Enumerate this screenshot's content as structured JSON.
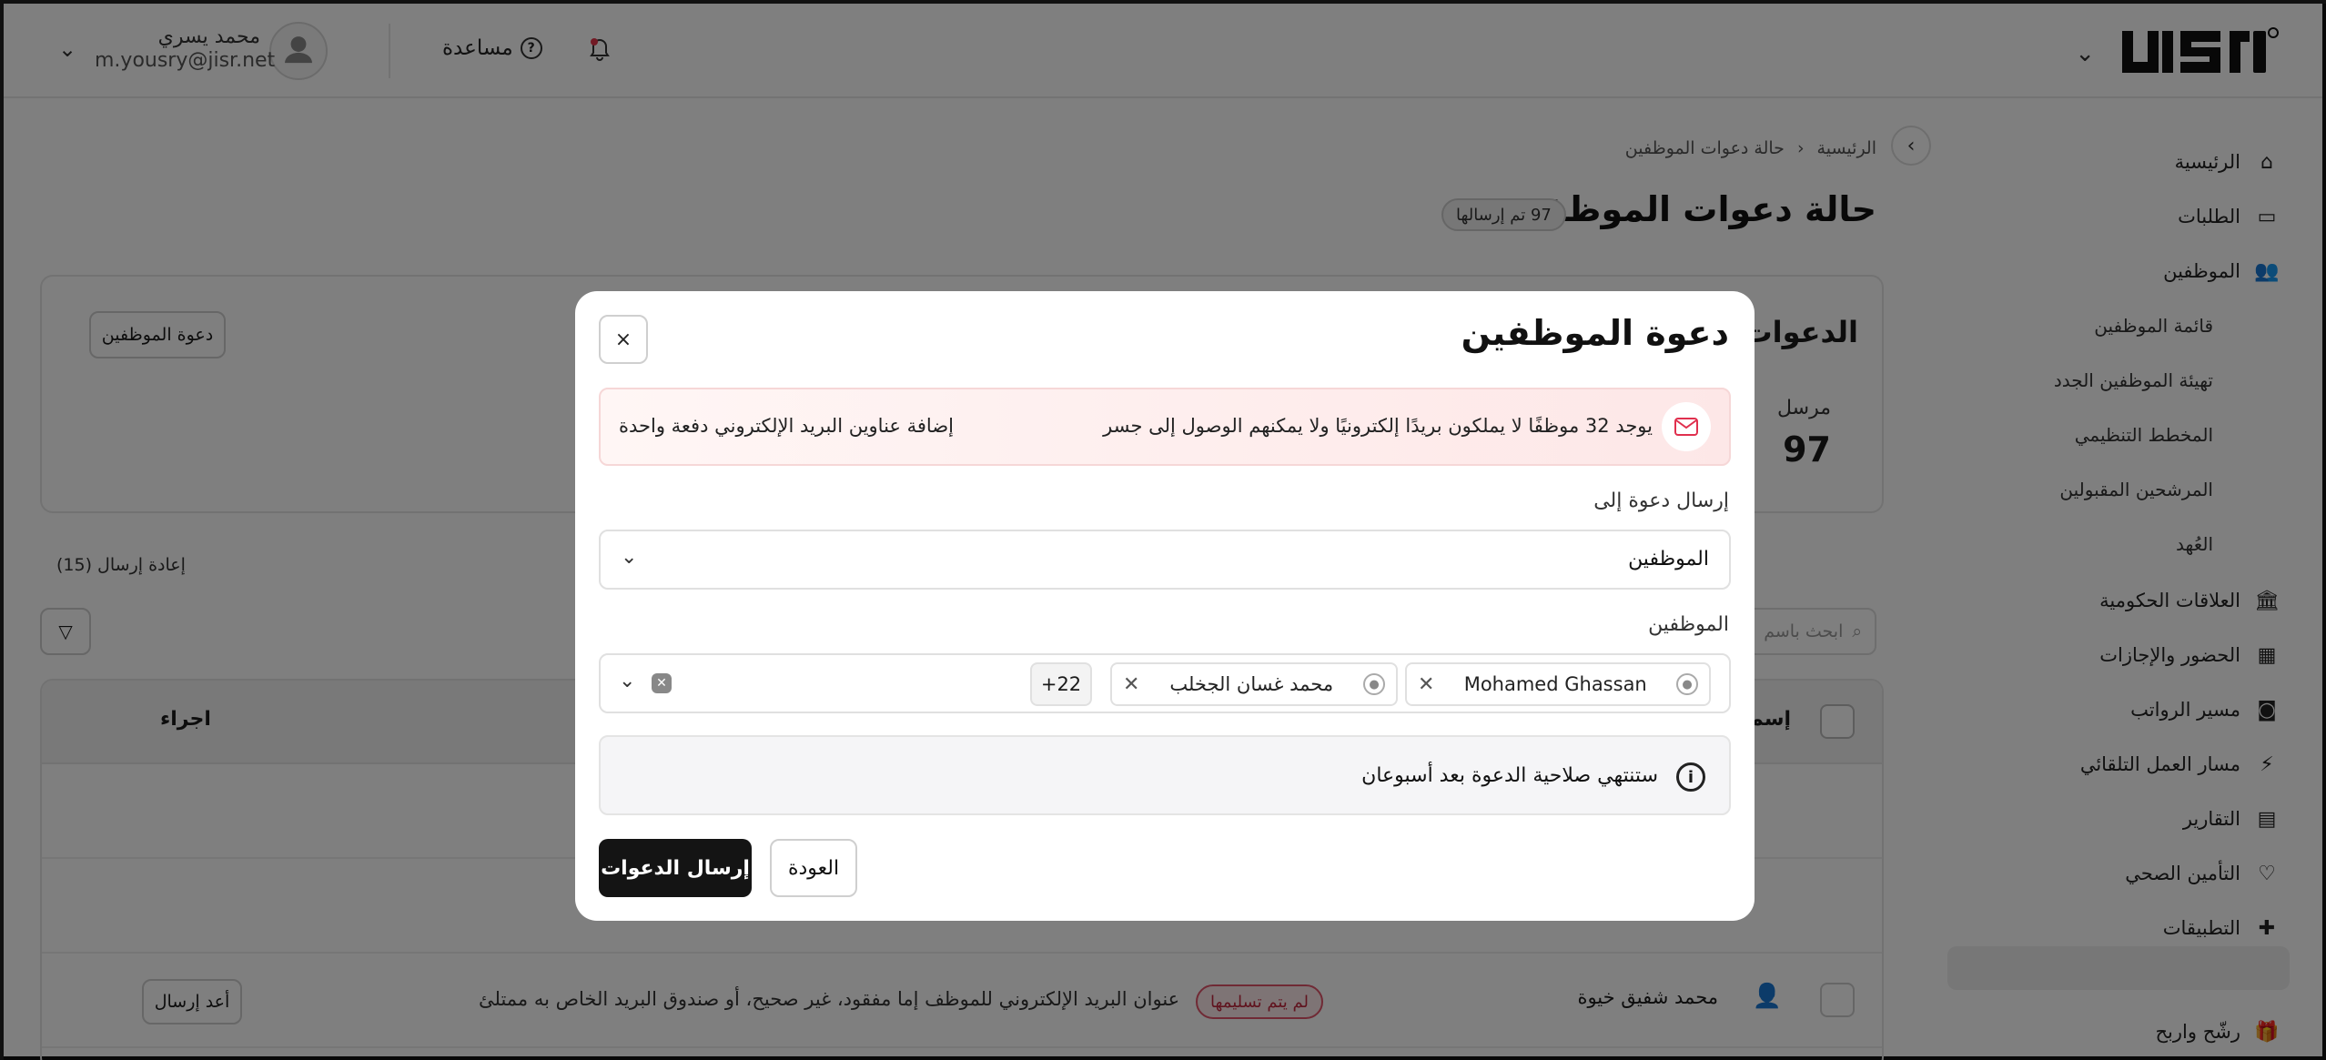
{
  "topbar": {
    "user_name": "محمد يسري",
    "user_email": "m.yousry@jisr.net",
    "help_label": "مساعدة"
  },
  "sidebar": {
    "items": [
      {
        "label": "الرئيسية",
        "icon": "home-icon"
      },
      {
        "label": "الطلبات",
        "icon": "inbox-icon"
      },
      {
        "label": "الموظفين",
        "icon": "users-icon"
      },
      {
        "label": "العلاقات الحكومية",
        "icon": "bank-icon"
      },
      {
        "label": "الحضور والإجازات",
        "icon": "calendar-icon"
      },
      {
        "label": "مسير الرواتب",
        "icon": "money-icon"
      },
      {
        "label": "مسار العمل التلقائي",
        "icon": "automation-icon"
      },
      {
        "label": "التقارير",
        "icon": "report-icon"
      },
      {
        "label": "التأمين الصحي",
        "icon": "health-icon"
      },
      {
        "label": "التطبيقات",
        "icon": "puzzle-icon"
      },
      {
        "label": "رشّح واربح",
        "icon": "gift-icon"
      }
    ],
    "sub_items": [
      "قائمة الموظفين",
      "تهيئة الموظفين الجدد",
      "المخطط التنظيمي",
      "المرشحين المقبولين",
      "العُهد"
    ]
  },
  "page": {
    "breadcrumb_home": "الرئيسية",
    "breadcrumb_current": "حالة دعوات الموظفين",
    "title": "حالة دعوات الموظفين",
    "sent_badge": "97 تم إرسالها",
    "card_title": "الدعوات",
    "invite_button": "دعوة الموظفين",
    "stat_label": "مرسل",
    "stat_value": "97",
    "resend_count": "إعادة إرسال (15)",
    "search_placeholder": "ابحث باسم",
    "table": {
      "header_action": "اجراء",
      "header_name": "إسم",
      "row": {
        "name": "محمد شفيق خيوة",
        "status": "لم يتم تسليمها",
        "reason": "عنوان البريد الإلكتروني للموظف إما مفقود، غير صحيح، أو صندوق البريد الخاص به ممتلئ",
        "action": "أعد إرسال"
      }
    }
  },
  "modal": {
    "title": "دعوة الموظفين",
    "close_label": "×",
    "alert_text": "يوجد 32 موظفًا لا يملكون بريدًا إلكترونيًا ولا يمكنهم الوصول إلى جسر",
    "alert_link": "إضافة عناوين البريد الإلكتروني دفعة واحدة",
    "send_to_label": "إرسال دعوة إلى",
    "send_to_value": "الموظفين",
    "employees_label": "الموظفين",
    "chips": [
      "Mohamed Ghassan",
      "محمد غسان الجخلب"
    ],
    "chips_more": "22+",
    "info_text": "ستنتهي صلاحية الدعوة بعد أسبوعان",
    "primary_button": "إرسال الدعوات",
    "secondary_button": "العودة"
  }
}
